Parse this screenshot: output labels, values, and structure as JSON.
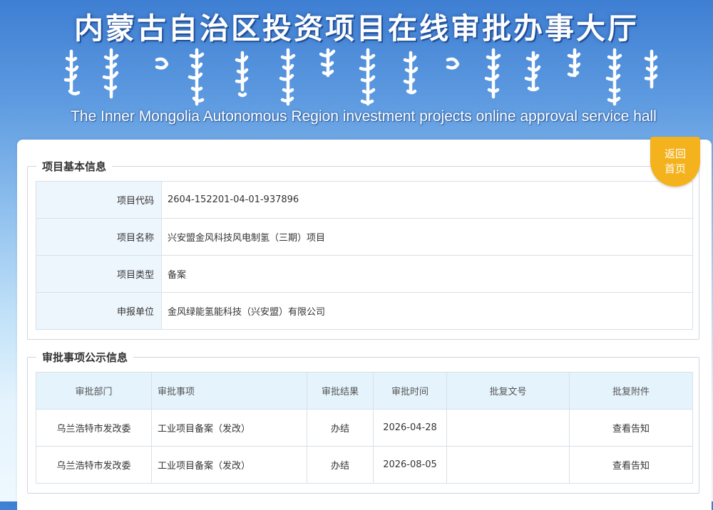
{
  "header": {
    "title_cn": "内蒙古自治区投资项目在线审批办事大厅",
    "title_en": "The Inner Mongolia Autonomous Region investment projects online approval service hall"
  },
  "back_button": {
    "line1": "返回",
    "line2": "首页"
  },
  "project_info": {
    "legend": "项目基本信息",
    "rows": [
      {
        "label": "项目代码",
        "value": "2604-152201-04-01-937896"
      },
      {
        "label": "项目名称",
        "value": "兴安盟金风科技风电制氢（三期）项目"
      },
      {
        "label": "项目类型",
        "value": "备案"
      },
      {
        "label": "申报单位",
        "value": "金风绿能氢能科技（兴安盟）有限公司"
      }
    ]
  },
  "approval_info": {
    "legend": "审批事项公示信息",
    "headers": [
      "审批部门",
      "审批事项",
      "审批结果",
      "审批时间",
      "批复文号",
      "批复附件"
    ],
    "rows": [
      {
        "dept": "乌兰浩特市发改委",
        "item": "工业项目备案（发改）",
        "result": "办结",
        "date": "2026-04-28",
        "doc_no": "",
        "attachment": "查看告知"
      },
      {
        "dept": "乌兰浩特市发改委",
        "item": "工业项目备案（发改）",
        "result": "办结",
        "date": "2026-08-05",
        "doc_no": "",
        "attachment": "查看告知"
      }
    ]
  },
  "colors": {
    "header_blue": "#3f7fd3",
    "label_bg": "#eef6fd",
    "table_header_bg": "#e5f3fc",
    "back_button": "#f4b21c"
  }
}
